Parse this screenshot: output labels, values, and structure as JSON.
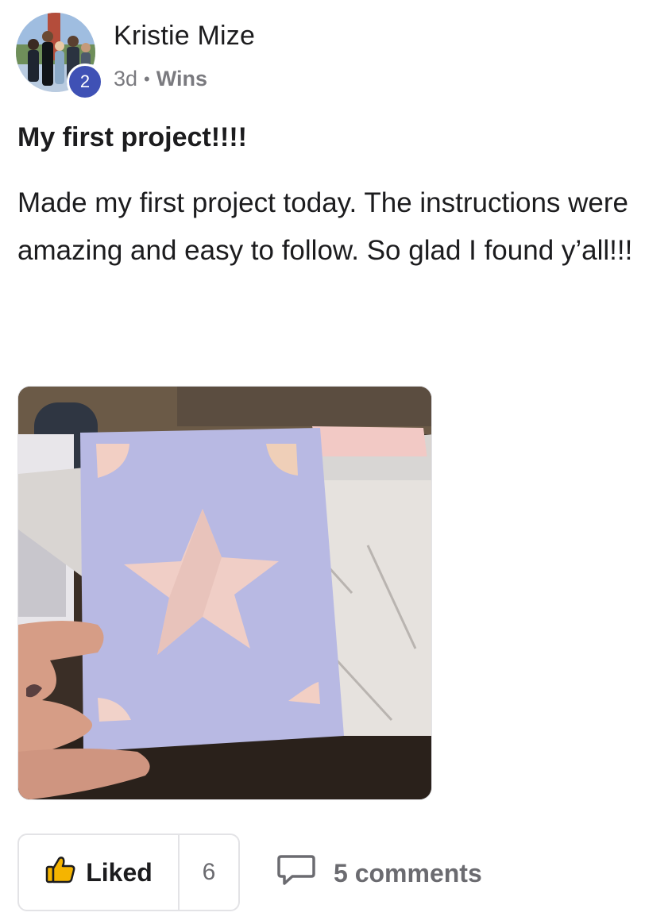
{
  "author": {
    "name": "Kristie Mize",
    "level_badge": "2",
    "avatar_icon": "avatar-photo"
  },
  "meta": {
    "time": "3d",
    "separator": "•",
    "category": "Wins"
  },
  "post": {
    "title": "My first project!!!!",
    "body": "Made my first project today. The instructions were amazing and easy to follow. So glad I found y’all!!!"
  },
  "image": {
    "icon": "star-card-photo"
  },
  "actions": {
    "like_label": "Liked",
    "like_count": "6",
    "like_icon": "thumbs-up-icon",
    "comments_label": "5 comments",
    "comments_icon": "comment-icon"
  },
  "colors": {
    "badge": "#3f51b5",
    "like_icon_fill": "#f5b400",
    "text_primary": "#1c1c1e",
    "text_secondary": "#7a7a7f"
  }
}
